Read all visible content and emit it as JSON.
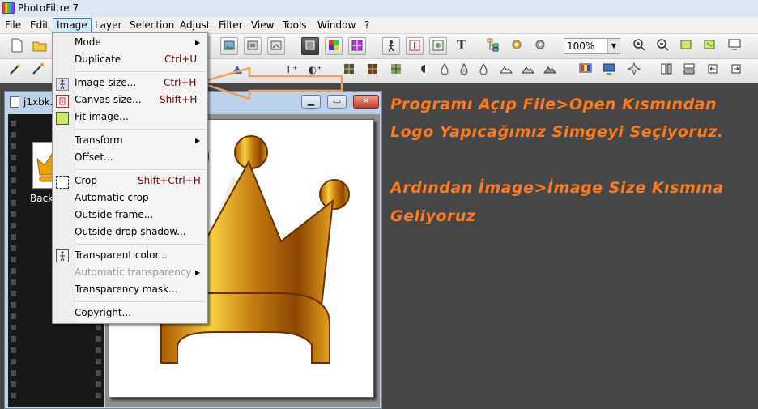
{
  "window": {
    "title": "PhotoFiltre 7"
  },
  "menubar": [
    "File",
    "Edit",
    "Image",
    "Layer",
    "Selection",
    "Adjust",
    "Filter",
    "View",
    "Tools",
    "Window",
    "?"
  ],
  "toolbar": {
    "zoom_value": "100%",
    "zoom_dropdown_glyph": "▼"
  },
  "glyphs": {
    "T": "T",
    "gamma_plus": "Γ⁺",
    "gamma_adj": "◐⁺"
  },
  "image_menu": {
    "mode": "Mode",
    "duplicate": "Duplicate",
    "duplicate_sc": "Ctrl+U",
    "image_size": "Image size...",
    "image_size_sc": "Ctrl+H",
    "canvas_size": "Canvas size...",
    "canvas_size_sc": "Shift+H",
    "fit_image": "Fit image...",
    "transform": "Transform",
    "offset": "Offset...",
    "crop": "Crop",
    "crop_sc": "Shift+Ctrl+H",
    "automatic_crop": "Automatic crop",
    "outside_frame": "Outside frame...",
    "outside_drop_shadow": "Outside drop shadow...",
    "transparent_color": "Transparent color...",
    "automatic_transparency": "Automatic transparency",
    "transparency_mask": "Transparency mask...",
    "copyright": "Copyright...",
    "submenu_arrow": "▶"
  },
  "document": {
    "title": "j1xbk.j",
    "thumbnail_label": "Back",
    "minimize": "▁",
    "maximize": "▭",
    "close": "✕"
  },
  "annotation": {
    "line1": "Programı Açıp File>Open Kısmından",
    "line2": "Logo Yapıcağımız Simgeyi Seçiyoruz.",
    "line3": "Ardından İmage>İmage Size Kısmına",
    "line4": "Geliyoruz"
  },
  "colors": {
    "annotation": "#ff7a1f",
    "arrow": "#f0a060",
    "gold_light": "#f8d040",
    "gold_dark": "#a85a00"
  }
}
